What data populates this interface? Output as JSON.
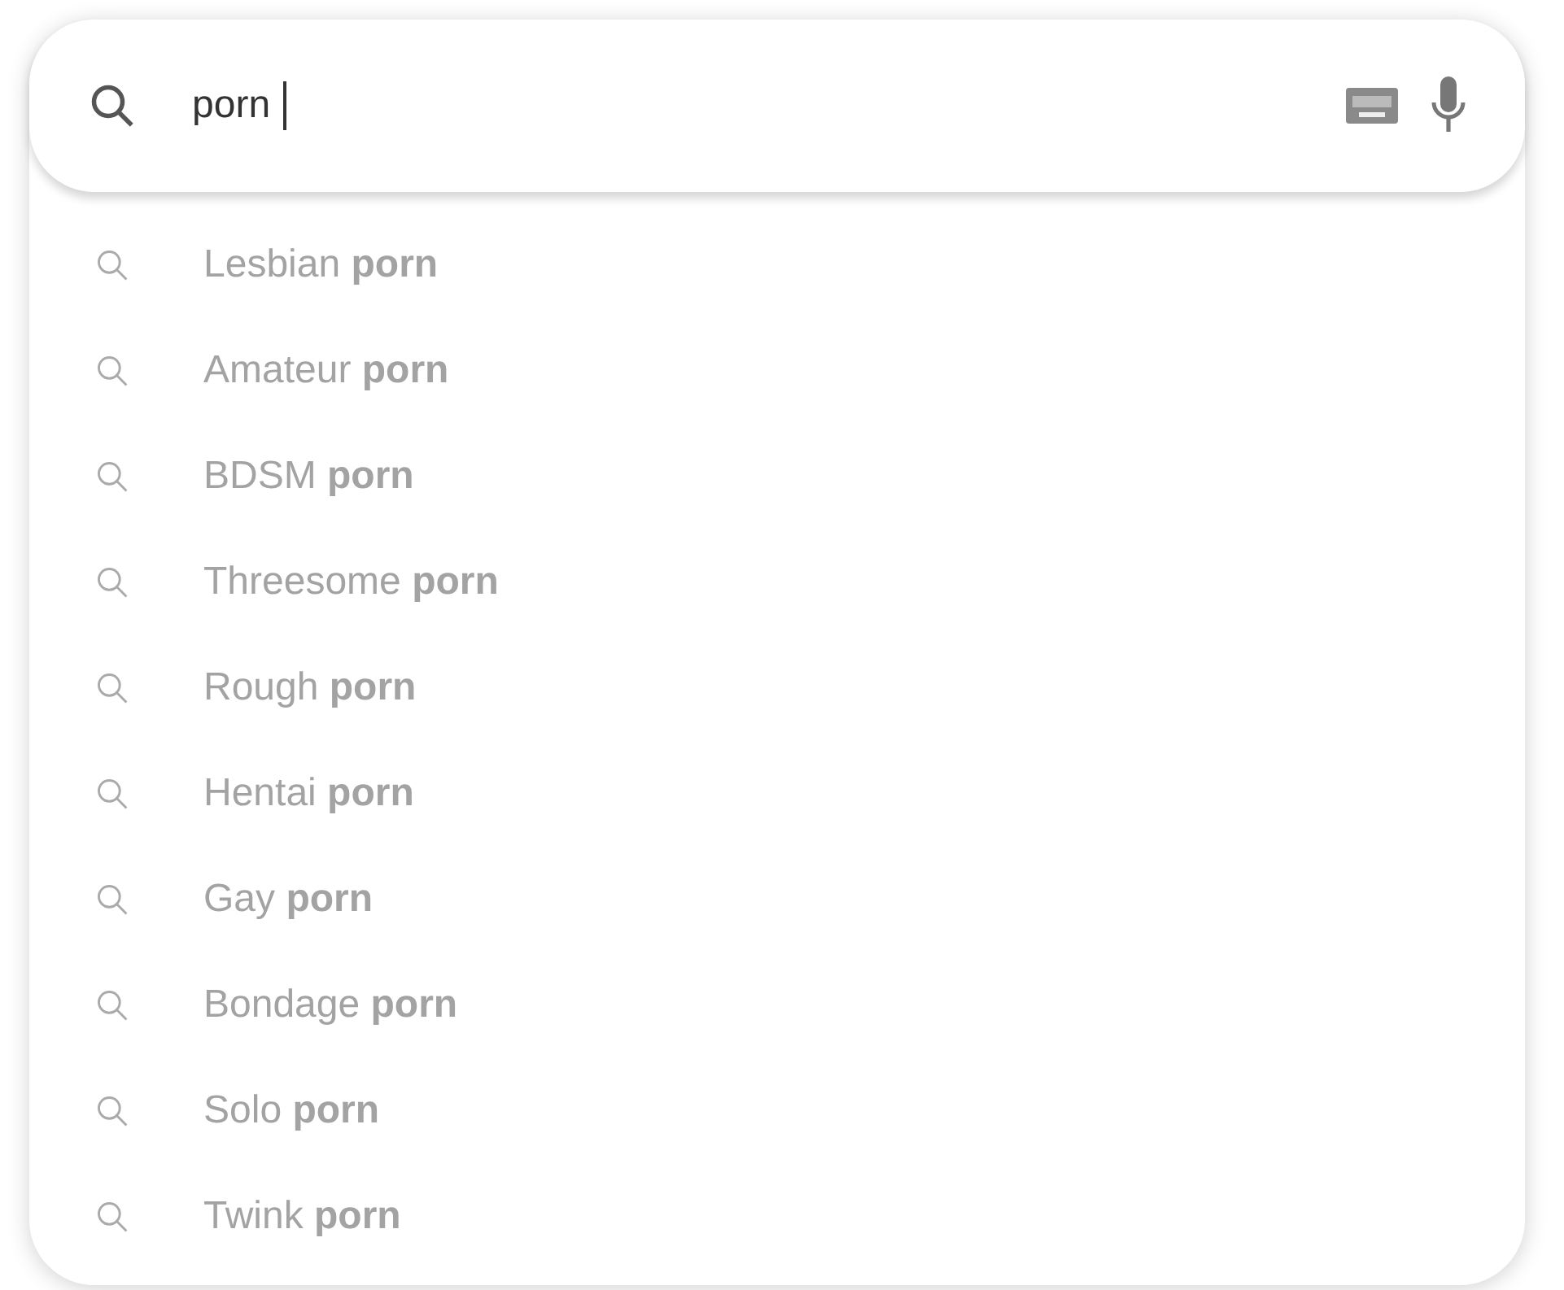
{
  "search": {
    "value": "porn"
  },
  "suggestions": [
    {
      "text": "Lesbian **porn**"
    },
    {
      "text": "Amateur **porn**"
    },
    {
      "text": "BDSM **porn**"
    },
    {
      "text": "Threesome **porn**"
    },
    {
      "text": "Rough **porn**"
    },
    {
      "text": "Hentai **porn**"
    },
    {
      "text": "Gay **porn**"
    },
    {
      "text": "Bondage **porn**"
    },
    {
      "text": "Solo **porn**"
    },
    {
      "text": "Twink **porn**"
    }
  ]
}
